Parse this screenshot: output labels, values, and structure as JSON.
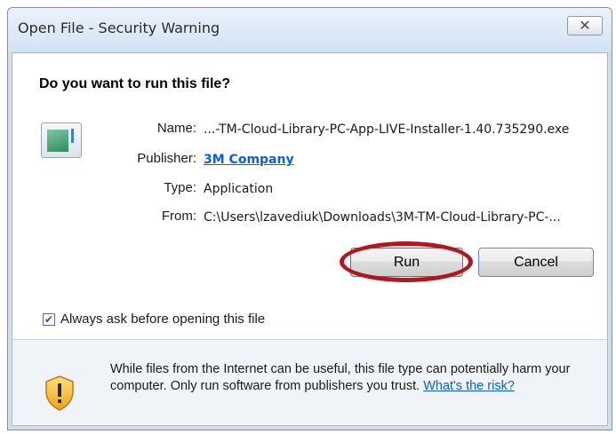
{
  "window": {
    "title": "Open File - Security Warning",
    "close_glyph": "✕"
  },
  "dialog": {
    "question": "Do you want to run this file?",
    "icon": "application-file-icon",
    "fields": {
      "name_label": "Name:",
      "name_value": "...-TM-Cloud-Library-PC-App-LIVE-Installer-1.40.735290.exe",
      "publisher_label": "Publisher:",
      "publisher_value": "3M Company",
      "type_label": "Type:",
      "type_value": "Application",
      "from_label": "From:",
      "from_value": "C:\\Users\\lzavediuk\\Downloads\\3M-TM-Cloud-Library-PC-..."
    },
    "buttons": {
      "run": "Run",
      "cancel": "Cancel"
    },
    "checkbox": {
      "label": "Always ask before opening this file",
      "checked": true
    },
    "warning": {
      "icon": "warning-shield-icon",
      "text": "While files from the Internet can be useful, this file type can potentially harm your computer. Only run software from publishers you trust.",
      "link": "What's the risk?"
    }
  },
  "colors": {
    "link": "#0b5ed7",
    "highlight": "#b3161f",
    "title_bar": "#d2e3f5"
  }
}
